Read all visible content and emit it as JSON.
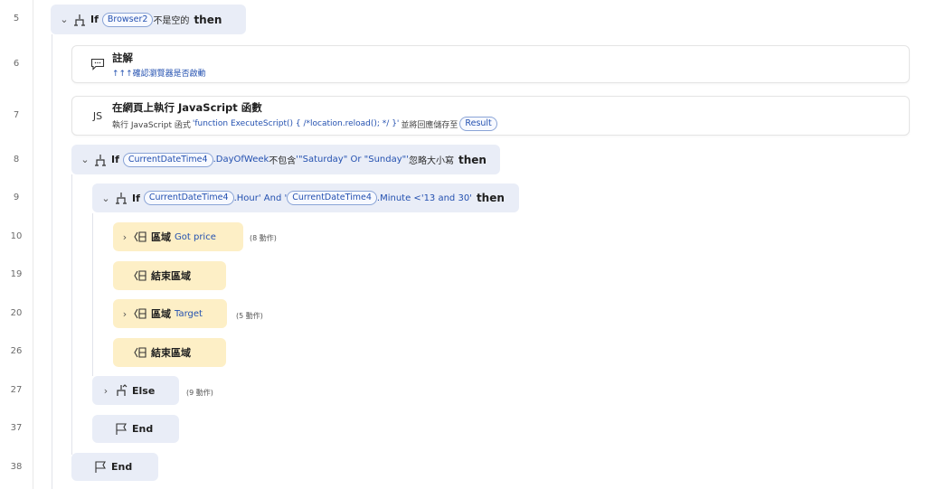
{
  "lines": [
    "5",
    "6",
    "7",
    "8",
    "9",
    "10",
    "19",
    "20",
    "26",
    "27",
    "37",
    "38"
  ],
  "row5": {
    "kw": "If",
    "var": "Browser2",
    "text": "不是空的",
    "then": "then"
  },
  "row6": {
    "title": "註解",
    "comment": "↑↑↑確認瀏覽器是否啟動"
  },
  "row7": {
    "icon": "JS",
    "title": "在網頁上執行 JavaScript 函數",
    "prefix": "執行 JavaScript 函式",
    "script": "'function ExecuteScript() { /*location.reload(); */ }'",
    "mid": "並將回應儲存至",
    "var": "Result"
  },
  "row8": {
    "kw": "If",
    "var": "CurrentDateTime4",
    "prop": ".DayOfWeek",
    "text1": "不包含",
    "value": "'\"Saturday\" Or \"Sunday\"'",
    "text2": "忽略大小寫",
    "then": "then"
  },
  "row9": {
    "kw": "If",
    "var1": "CurrentDateTime4",
    "prop1": ".Hour' And '",
    "var2": "CurrentDateTime4",
    "prop2": ".Minute <'13 and 30'",
    "then": "then"
  },
  "row10": {
    "kw": "區域",
    "name": "Got price",
    "count": "(8 動作)"
  },
  "row19": {
    "kw": "結束區域"
  },
  "row20": {
    "kw": "區域",
    "name": "Target",
    "count": "(5 動作)"
  },
  "row26": {
    "kw": "結束區域"
  },
  "row27": {
    "kw": "Else",
    "count": "(9 動作)"
  },
  "row37": {
    "kw": "End"
  },
  "row38": {
    "kw": "End"
  },
  "colors": {
    "if_bg": "#e9edf7",
    "region_bg": "#fdefc6",
    "var_border": "#8aa4d6",
    "link": "#2451b0"
  }
}
